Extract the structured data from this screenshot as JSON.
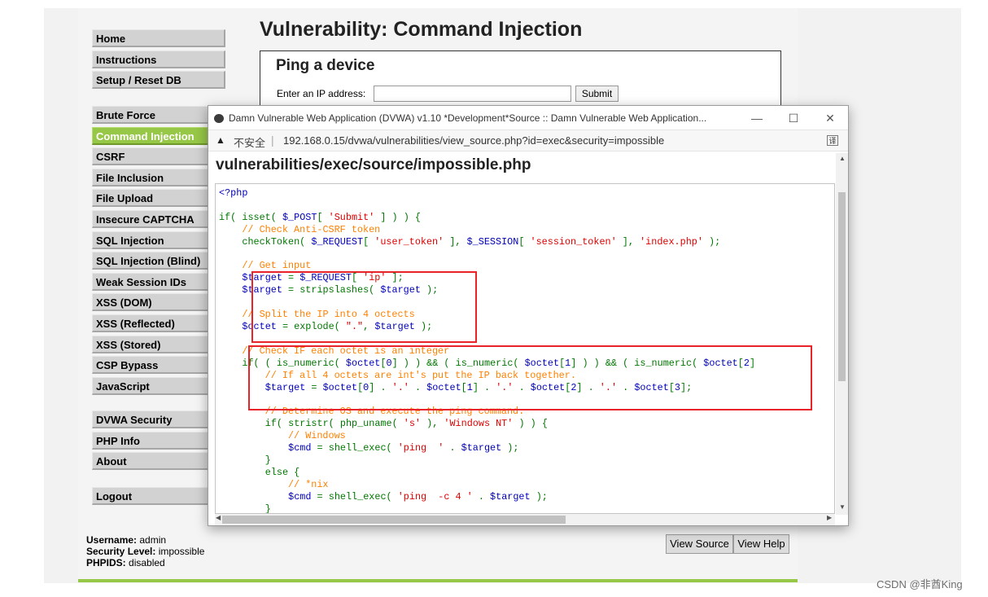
{
  "menu": {
    "group1": [
      "Home",
      "Instructions",
      "Setup / Reset DB"
    ],
    "group2": [
      "Brute Force",
      "Command Injection",
      "CSRF",
      "File Inclusion",
      "File Upload",
      "Insecure CAPTCHA",
      "SQL Injection",
      "SQL Injection (Blind)",
      "Weak Session IDs",
      "XSS (DOM)",
      "XSS (Reflected)",
      "XSS (Stored)",
      "CSP Bypass",
      "JavaScript"
    ],
    "group3": [
      "DVWA Security",
      "PHP Info",
      "About"
    ],
    "group4": [
      "Logout"
    ],
    "active": "Command Injection"
  },
  "page": {
    "title": "Vulnerability: Command Injection",
    "ping_title": "Ping a device",
    "ip_label": "Enter an IP address:",
    "ip_value": "",
    "submit_label": "Submit"
  },
  "user_info": {
    "username_label": "Username:",
    "username": "admin",
    "security_label": "Security Level:",
    "security": "impossible",
    "phpids_label": "PHPIDS:",
    "phpids": "disabled"
  },
  "buttons": {
    "view_source": "View Source",
    "view_help": "View Help"
  },
  "popup": {
    "title": "Damn Vulnerable Web Application (DVWA) v1.10 *Development*Source :: Damn Vulnerable Web Application...",
    "insecure": "不安全",
    "url": "192.168.0.15/dvwa/vulnerabilities/view_source.php?id=exec&security=impossible",
    "heading": "vulnerabilities/exec/source/impossible.php",
    "minimize": "—",
    "maximize": "☐",
    "close": "✕",
    "code_lines": [
      "<?php",
      "",
      "if( isset( $_POST[ 'Submit' ] ) ) {",
      "    // Check Anti-CSRF token",
      "    checkToken( $_REQUEST[ 'user_token' ], $_SESSION[ 'session_token' ], 'index.php' );",
      "",
      "    // Get input",
      "    $target = $_REQUEST[ 'ip' ];",
      "    $target = stripslashes( $target );",
      "",
      "    // Split the IP into 4 octects",
      "    $octet = explode( \".\", $target );",
      "",
      "    // Check IF each octet is an integer",
      "    if( ( is_numeric( $octet[0] ) ) && ( is_numeric( $octet[1] ) ) && ( is_numeric( $octet[2]",
      "        // If all 4 octets are int's put the IP back together.",
      "        $target = $octet[0] . '.' . $octet[1] . '.' . $octet[2] . '.' . $octet[3];",
      "",
      "        // Determine OS and execute the ping command.",
      "        if( stristr( php_uname( 's' ), 'Windows NT' ) ) {",
      "            // Windows",
      "            $cmd = shell_exec( 'ping  ' . $target );",
      "        }",
      "        else {",
      "            // *nix",
      "            $cmd = shell_exec( 'ping  -c 4 ' . $target );",
      "        }"
    ]
  },
  "watermark": "CSDN @非酋King",
  "colors": {
    "active_menu": "#97c747",
    "highlight_border": "#e8232a",
    "php_keyword": "#007700",
    "php_variable": "#0000bb",
    "php_string": "#dd0000",
    "php_comment": "#ff8000"
  }
}
